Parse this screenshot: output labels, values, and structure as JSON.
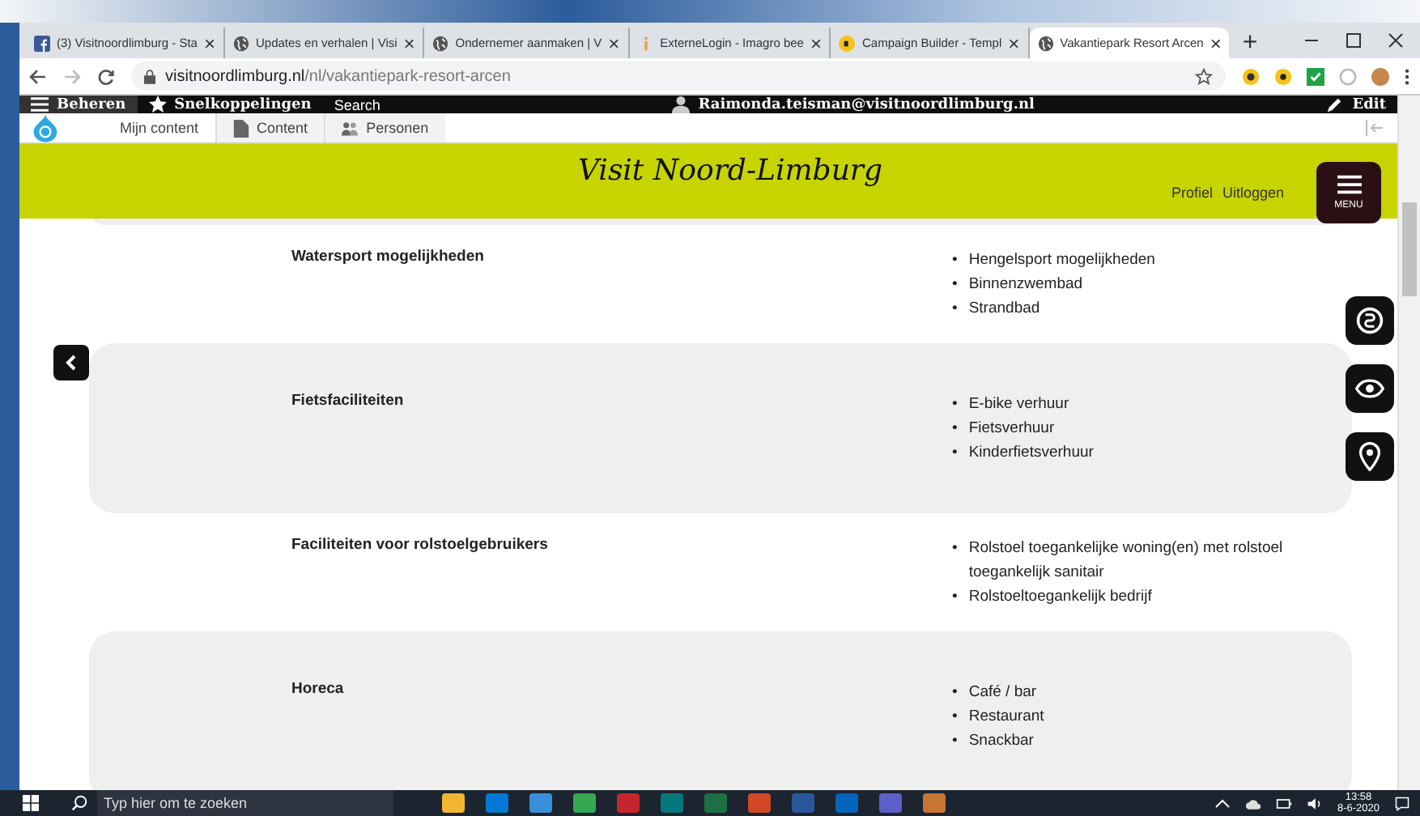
{
  "browser": {
    "tabs": [
      {
        "kind": "facebook",
        "title": "(3) Visitnoordlimburg - Sta",
        "close": "×",
        "selected": false
      },
      {
        "kind": "globe",
        "title": "Updates en verhalen | Visi",
        "close": "×",
        "selected": false
      },
      {
        "kind": "globe",
        "title": "Ondernemer aanmaken | V",
        "close": "×",
        "selected": false
      },
      {
        "kind": "info",
        "title": "ExterneLogin - Imagro bee",
        "close": "×",
        "selected": false
      },
      {
        "kind": "campaign",
        "title": "Campaign Builder - Templ",
        "close": "×",
        "selected": false
      },
      {
        "kind": "globe",
        "title": "Vakantiepark Resort Arcen",
        "close": "×",
        "selected": true
      }
    ],
    "new_tab": "+",
    "address_host": "visitnoordlimburg.nl",
    "address_path": "/nl/vakantiepark-resort-arcen"
  },
  "admin_toolbar": {
    "manage": "Beheren",
    "shortcuts": "Snelkoppelingen",
    "search": "Search",
    "user": "Raimonda.teisman@visitnoordlimburg.nl",
    "edit": "Edit"
  },
  "admin_tray": [
    {
      "kind": "plain",
      "label": "Mijn content",
      "selected": false
    },
    {
      "kind": "document",
      "label": "Content",
      "selected": true
    },
    {
      "kind": "people",
      "label": "Personen",
      "selected": true
    }
  ],
  "header": {
    "logo": "Visit Noord-Limburg",
    "links": [
      "Profiel",
      "Uitloggen"
    ],
    "menu": "MENU"
  },
  "facilities": [
    {
      "label": "Watersport mogelijkheden",
      "bullet": "•",
      "shaded": false,
      "items": [
        "Hengelsport mogelijkheden",
        "Binnenzwembad",
        "Strandbad"
      ]
    },
    {
      "label": "Fietsfaciliteiten",
      "bullet": "•",
      "shaded": true,
      "items": [
        "E-bike verhuur",
        "Fietsverhuur",
        "Kinderfietsverhuur"
      ]
    },
    {
      "label": "Faciliteiten voor rolstoelgebruikers",
      "bullet": "•",
      "shaded": false,
      "items": [
        "Rolstoel toegankelijke woning(en) met rolstoel toegankelijk sanitair",
        "Rolstoeltoegankelijk bedrijf"
      ]
    },
    {
      "label": "Horeca",
      "bullet": "•",
      "shaded": true,
      "items": [
        "Café / bar",
        "Restaurant",
        "Snackbar"
      ]
    }
  ],
  "taskbar": {
    "search_placeholder": "Typ hier om te zoeken",
    "time": "13:58",
    "date": "8-6-2020",
    "apps": [
      {
        "color": "#f2b632"
      },
      {
        "color": "#0078d4"
      },
      {
        "color": "#3a8fd9"
      },
      {
        "color": "#34a853"
      },
      {
        "color": "#c4262e"
      },
      {
        "color": "#03787c"
      },
      {
        "color": "#1d7044"
      },
      {
        "color": "#d24726"
      },
      {
        "color": "#2b579a"
      },
      {
        "color": "#0364b8"
      },
      {
        "color": "#5b5fc7"
      },
      {
        "color": "#c87533"
      }
    ]
  }
}
